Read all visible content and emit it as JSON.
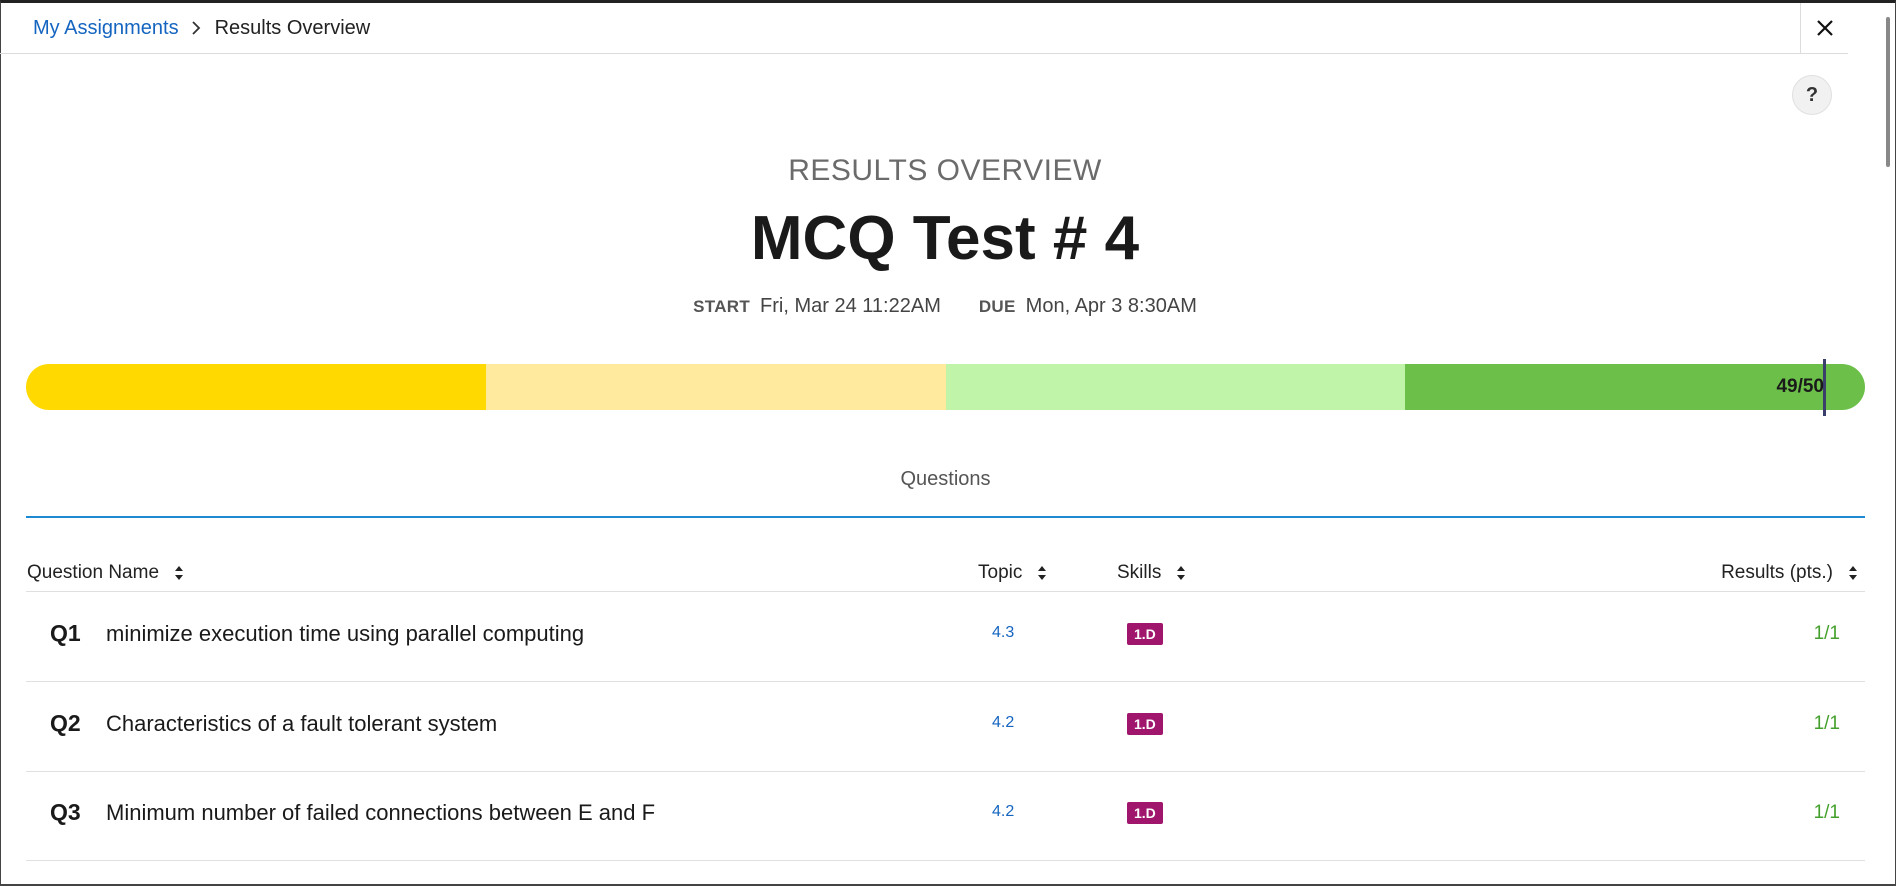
{
  "breadcrumb": {
    "parent": "My Assignments",
    "current": "Results Overview"
  },
  "header": {
    "eyebrow": "RESULTS OVERVIEW",
    "title": "MCQ Test # 4",
    "start_label": "START",
    "start_value": "Fri, Mar 24 11:22AM",
    "due_label": "DUE",
    "due_value": "Mon, Apr 3 8:30AM"
  },
  "help_label": "?",
  "score": {
    "label": "49/50",
    "earned": 49,
    "total": 50
  },
  "progress_colors": [
    "#ffd900",
    "#ffea9e",
    "#c0f4a9",
    "#6cc04a"
  ],
  "tabs": [
    {
      "label": "Questions"
    }
  ],
  "table": {
    "columns": {
      "question_name": "Question Name",
      "topic": "Topic",
      "skills": "Skills",
      "results": "Results (pts.)"
    },
    "rows": [
      {
        "num": "Q1",
        "name": "minimize execution time using parallel computing",
        "topic": "4.3",
        "skill": "1.D",
        "result": "1/1"
      },
      {
        "num": "Q2",
        "name": "Characteristics of a fault tolerant system",
        "topic": "4.2",
        "skill": "1.D",
        "result": "1/1"
      },
      {
        "num": "Q3",
        "name": "Minimum number of failed connections between E and F",
        "topic": "4.2",
        "skill": "1.D",
        "result": "1/1"
      }
    ]
  },
  "colors": {
    "link": "#1565c0",
    "skill_badge": "#a0166d",
    "result_text": "#44a02c",
    "tab_underline": "#1e88d2"
  }
}
